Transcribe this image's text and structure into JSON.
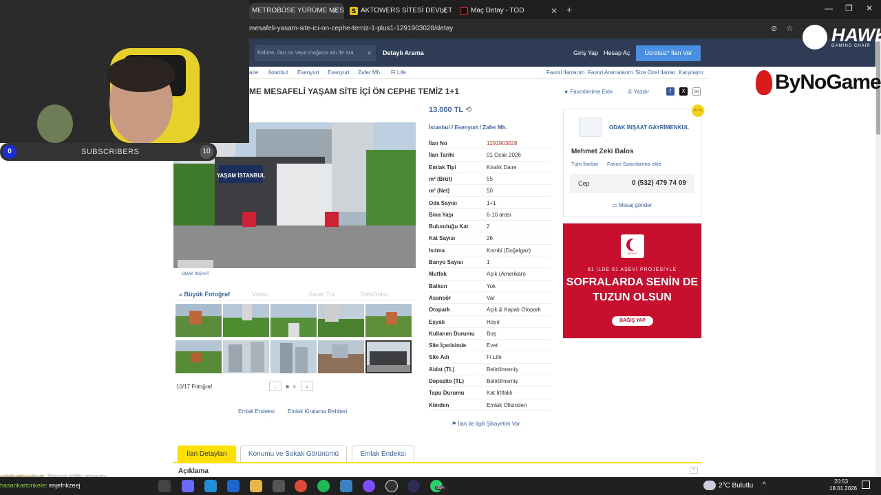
{
  "browser": {
    "tabs": [
      {
        "title": "METROBÜSE YÜRÜME MESAFE",
        "active": false
      },
      {
        "title": "AKTOWERS SİTESİ DEVLET HAS",
        "active": false
      },
      {
        "title": "Maç Detay - TOD",
        "active": true
      }
    ],
    "new_tab": "+",
    "url": "mesafeli-yasam-site-ici-on-cephe-temiz-1-plus1-1291903028/detay",
    "window": {
      "minimize": "—",
      "restore": "❐",
      "close": "✕"
    }
  },
  "site_header": {
    "search_placeholder": "Kelime, ilan no veya mağaza adı ile ara",
    "detailed_search": "Detaylı Arama",
    "login": "Giriş Yap",
    "register": "Hesap Aç",
    "free_listing": "Ücretsiz* İlan Ver"
  },
  "breadcrumb": [
    "aire",
    "İstanbul",
    "Esenyurt",
    "Esenyurt",
    "Zafer Mh.",
    "Fi Life"
  ],
  "fav_links": [
    "Favori İlanlarım",
    "Favori Aramalarım",
    "Size Özel İlanlar",
    "Karşılaştır"
  ],
  "listing": {
    "title": "ME MESAFELİ YAŞAM SİTE İÇİ ÖN CEPHE TEMİZ 1+1",
    "add_favorites": "Favorilerime Ekle",
    "print": "Yazdır",
    "price": "13.000 TL",
    "location": [
      "İstanbul",
      "Esenyurt",
      "Zafer Mh."
    ],
    "details": [
      {
        "k": "İlan No",
        "v": "1291903028",
        "red": true
      },
      {
        "k": "İlan Tarihi",
        "v": "01 Ocak 2026"
      },
      {
        "k": "Emlak Tipi",
        "v": "Kiralık Daire"
      },
      {
        "k": "m² (Brüt)",
        "v": "55"
      },
      {
        "k": "m² (Net)",
        "v": "50"
      },
      {
        "k": "Oda Sayısı",
        "v": "1+1"
      },
      {
        "k": "Bina Yaşı",
        "v": "6-10 arası"
      },
      {
        "k": "Bulunduğu Kat",
        "v": "2"
      },
      {
        "k": "Kat Sayısı",
        "v": "26"
      },
      {
        "k": "Isıtma",
        "v": "Kombi (Doğalgaz)"
      },
      {
        "k": "Banyo Sayısı",
        "v": "1"
      },
      {
        "k": "Mutfak",
        "v": "Açık (Amerikan)"
      },
      {
        "k": "Balkon",
        "v": "Yok"
      },
      {
        "k": "Asansör",
        "v": "Var"
      },
      {
        "k": "Otopark",
        "v": "Açık & Kapalı Otopark"
      },
      {
        "k": "Eşyalı",
        "v": "Hayır"
      },
      {
        "k": "Kullanım Durumu",
        "v": "Boş"
      },
      {
        "k": "Site İçerisinde",
        "v": "Evet"
      },
      {
        "k": "Site Adı",
        "v": "Fi Life"
      },
      {
        "k": "Aidat (TL)",
        "v": "Belirtilmemiş"
      },
      {
        "k": "Depozito (TL)",
        "v": "Belirtilmemiş"
      },
      {
        "k": "Tapu Durumu",
        "v": "Kat İrtifaklı"
      },
      {
        "k": "Kimden",
        "v": "Emlak Ofisinden"
      }
    ],
    "complaint": "İlan ile İlgili Şikayetim Var"
  },
  "gallery": {
    "big_photo": "Büyük Fotoğraf",
    "video": "Video",
    "virtual_tour": "Sanal Tur",
    "owner": "SahiDoku",
    "counter": "10/17 Fotoğraf",
    "sign_text": "YAŞAM İSTANBUL",
    "watermark": "ODAK İNŞAAT",
    "links": [
      "Emlak Endeksi",
      "Emlak Kiralama Rehberi"
    ]
  },
  "seller": {
    "company": "ODAK İNŞAAT GAYRİMENKUL",
    "name": "Mehmet Zeki Balos",
    "all_listings": "Tüm İlanları",
    "add_fav": "Favori Satıcılarıma ekle",
    "phone_label": "Cep",
    "phone": "0 (532) 479 74 09",
    "message": "Mesaj gönder",
    "badge": "15 YIL"
  },
  "ad": {
    "brand": "KIZILAY",
    "small": "81 İLDE 81 AŞEVİ PROJESİYLE",
    "line1": "SOFRALARDA SENİN DE",
    "line2": "TUZUN OLSUN",
    "button": "BAĞIŞ YAP"
  },
  "page_tabs": [
    "İlan Detayları",
    "Konumu ve Sokak Görünümü",
    "Emlak Endeksi"
  ],
  "section_title": "Açıklama",
  "stream": {
    "sub_count": "0",
    "sub_label": "SUBSCRIBERS",
    "sub_goal": "10",
    "hawk": "HAWK",
    "hawk_sub": "GAMING CHAIR",
    "sponsor": "ByNoGame",
    "chat": [
      {
        "user": "selahattinselcuk",
        "msg": ": Takıma küfür etmeyin"
      },
      {
        "user": "hasankartonkele",
        "msg": ": enjefnkzeej"
      }
    ]
  },
  "taskbar": {
    "weather": "2°C  Bulutlu",
    "time": "20:53",
    "date": "18.01.2026",
    "badge": "99+"
  },
  "colors": {
    "link": "#3a64a8",
    "header": "#2e3c56",
    "accent": "#4a90e2",
    "tab_active": "#ffe000"
  }
}
